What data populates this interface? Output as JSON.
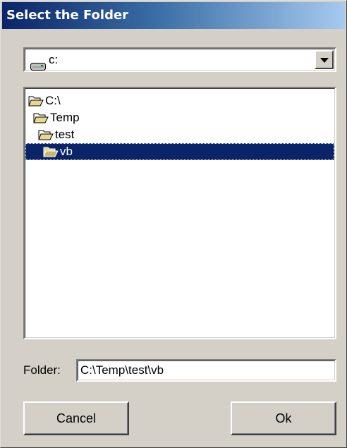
{
  "dialog": {
    "title": "Select the Folder"
  },
  "drive_select": {
    "value": "c:",
    "icon": "drive-icon"
  },
  "tree": {
    "items": [
      {
        "label": "C:\\",
        "icon": "open-folder-icon",
        "selected": false
      },
      {
        "label": "Temp",
        "icon": "open-folder-icon",
        "selected": false
      },
      {
        "label": "test",
        "icon": "open-folder-icon",
        "selected": false
      },
      {
        "label": "vb",
        "icon": "open-folder-icon",
        "selected": true
      }
    ]
  },
  "folder_field": {
    "label": "Folder:",
    "value": "C:\\Temp\\test\\vb"
  },
  "buttons": {
    "cancel": "Cancel",
    "ok": "Ok"
  },
  "colors": {
    "title_start": "#0a246a",
    "title_end": "#a6caf0",
    "face": "#d4d0c8",
    "selection": "#0a246a"
  }
}
